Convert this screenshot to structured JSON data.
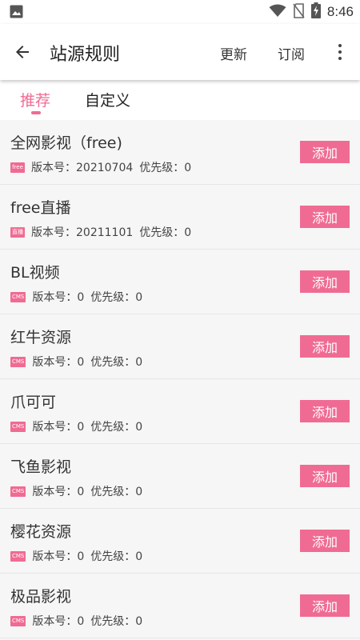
{
  "status_bar": {
    "time": "8:46",
    "left_icon": "image-icon",
    "right_icons": [
      "wifi-icon",
      "no-sim-icon",
      "battery-charging-icon"
    ]
  },
  "app_bar": {
    "title": "站源规则",
    "actions": {
      "update": "更新",
      "subscribe": "订阅"
    }
  },
  "tabs": [
    {
      "label": "推荐",
      "active": true
    },
    {
      "label": "自定义",
      "active": false
    }
  ],
  "colors": {
    "accent": "#f06b93"
  },
  "sources": [
    {
      "name": "全网影视（free)",
      "tag": "free",
      "version": "版本号：20210704",
      "priority": "优先级：0",
      "button": "添加"
    },
    {
      "name": "free直播",
      "tag": "直播",
      "version": "版本号：20211101",
      "priority": "优先级：0",
      "button": "添加"
    },
    {
      "name": "BL视频",
      "tag": "CMS",
      "version": "版本号：0",
      "priority": "优先级：0",
      "button": "添加"
    },
    {
      "name": "红牛资源",
      "tag": "CMS",
      "version": "版本号：0",
      "priority": "优先级：0",
      "button": "添加"
    },
    {
      "name": "爪可可",
      "tag": "CMS",
      "version": "版本号：0",
      "priority": "优先级：0",
      "button": "添加"
    },
    {
      "name": "飞鱼影视",
      "tag": "CMS",
      "version": "版本号：0",
      "priority": "优先级：0",
      "button": "添加"
    },
    {
      "name": "樱花资源",
      "tag": "CMS",
      "version": "版本号：0",
      "priority": "优先级：0",
      "button": "添加"
    },
    {
      "name": "极品影视",
      "tag": "CMS",
      "version": "版本号：0",
      "priority": "优先级：0",
      "button": "添加"
    }
  ]
}
